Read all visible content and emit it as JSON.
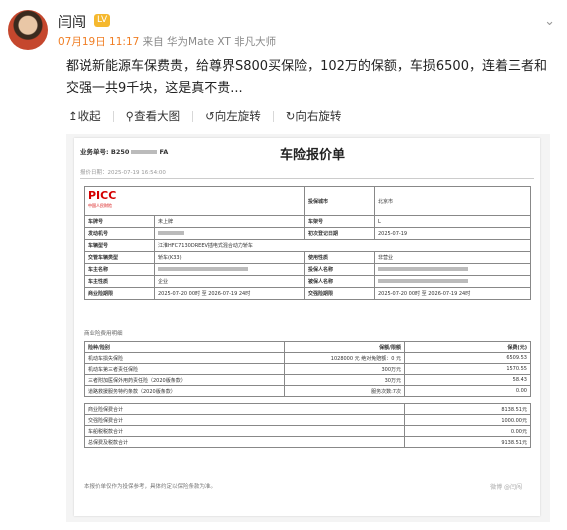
{
  "post": {
    "user_name": "闫闯",
    "badge": "LV",
    "date": "07月19日 11:17",
    "source": "来自 华为Mate XT 非凡大师",
    "text": "都说新能源车保费贵，给尊界S800买保险，102万的保额，车损6500，连着三者和交强一共9千块，这是真不贵..."
  },
  "toolbar": {
    "collapse": "收起",
    "view_large": "查看大图",
    "rotate_left": "向左旋转",
    "rotate_right": "向右旋转"
  },
  "doc": {
    "order_prefix": "业务单号: B250",
    "order_suffix": "FA",
    "title": "车险报价单",
    "quote_time": "报价日期：2025-07-19 16:54:00",
    "logo": "PICC",
    "logo_sub": "中国人民财险",
    "info_rows": [
      [
        "车牌号",
        "未上牌",
        "车架号",
        "L"
      ],
      [
        "发动机号",
        "",
        "初次登记日期",
        "2025-07-19"
      ],
      [
        "车辆型号",
        "江淮HFC7130DREEV插电式混合动力轿车",
        "",
        ""
      ],
      [
        "交管车辆类型",
        "轿车(K33)",
        "使用性质",
        "非营业"
      ],
      [
        "车主名称",
        "",
        "投保人名称",
        ""
      ],
      [
        "车主性质",
        "企业",
        "被保人名称",
        ""
      ],
      [
        "商业险期限",
        "2025-07-20 00时 至 2026-07-19 24时",
        "交强险期限",
        "2025-07-20 00时 至 2026-07-19 24时"
      ]
    ],
    "info_extra": {
      "city_label": "投保城市",
      "city_value": "北京市"
    },
    "section_label": "商业险费用明细",
    "cov_header": [
      "险种/险别",
      "",
      "保额/限额",
      "保费(元)"
    ],
    "cov_rows": [
      [
        "机动车损失保险",
        "1028000 元 绝对免赔额：0 元",
        "6509.53"
      ],
      [
        "机动车第三者责任保险",
        "300万元",
        "1570.55"
      ],
      [
        "三者附加医保外用药责任险（2020版条款）",
        "30万元",
        "58.43"
      ],
      [
        "道路救援服务特约条款（2020版条款）",
        "服务次数:7次",
        "0.00"
      ]
    ],
    "totals": [
      [
        "商业险保费合计",
        "8138.51元"
      ],
      [
        "交强险保费合计",
        "1000.00元"
      ],
      [
        "车船税税款合计",
        "0.00元"
      ],
      [
        "总保费及税款合计",
        "9138.51元"
      ]
    ],
    "foot_note": "本报价单仅作为投保参考，具体约定以保险条款为准。",
    "watermark": "微博 @闫闯"
  }
}
